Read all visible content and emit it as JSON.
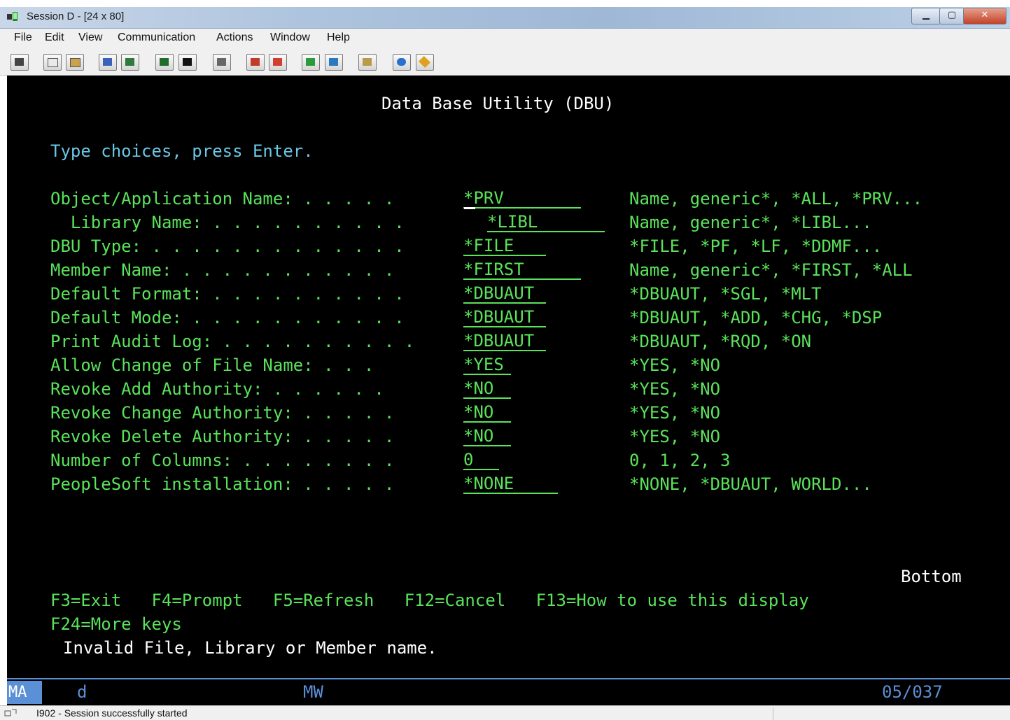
{
  "window": {
    "title": "Session D - [24 x 80]"
  },
  "menu": [
    "File",
    "Edit",
    "View",
    "Communication",
    "Actions",
    "Window",
    "Help"
  ],
  "toolbar_icons": [
    "print-screen-icon",
    "copy-icon",
    "paste-icon",
    "send-icon",
    "receive-icon",
    "display-icon",
    "keypad-icon",
    "macro-icon",
    "record-macro-icon",
    "stop-macro-icon",
    "play-macro-icon",
    "run-macro-icon",
    "clipboard-icon",
    "globe-icon",
    "map-icon"
  ],
  "screen": {
    "title": "Data Base Utility (DBU)",
    "instruction": "Type choices, press Enter.",
    "fields": [
      {
        "label": "Object/Application Name: . . . . .",
        "value": "*PRV",
        "hint": "Name, generic*, *ALL, *PRV..."
      },
      {
        "label": "  Library Name: . . . . . . . . . .",
        "value": "*LIBL",
        "hint": "Name, generic*, *LIBL..."
      },
      {
        "label": "DBU Type: . . . . . . . . . . . . .",
        "value": "*FILE",
        "hint": "*FILE, *PF, *LF, *DDMF..."
      },
      {
        "label": "Member Name: . . . . . . . . . . .",
        "value": "*FIRST",
        "hint": "Name, generic*, *FIRST, *ALL"
      },
      {
        "label": "Default Format: . . . . . . . . . .",
        "value": "*DBUAUT",
        "hint": "*DBUAUT, *SGL, *MLT"
      },
      {
        "label": "Default Mode: . . . . . . . . . . .",
        "value": "*DBUAUT",
        "hint": "*DBUAUT, *ADD, *CHG, *DSP"
      },
      {
        "label": "Print Audit Log: . . . . . . . . . .",
        "value": "*DBUAUT",
        "hint": "*DBUAUT, *RQD, *ON"
      },
      {
        "label": "Allow Change of File Name: . . .",
        "value": "*YES",
        "hint": "*YES, *NO"
      },
      {
        "label": "Revoke Add Authority: . . . . . .",
        "value": "*NO",
        "hint": "*YES, *NO"
      },
      {
        "label": "Revoke Change Authority: . . . . .",
        "value": "*NO",
        "hint": "*YES, *NO"
      },
      {
        "label": "Revoke Delete Authority: . . . . .",
        "value": "*NO",
        "hint": "*YES, *NO"
      },
      {
        "label": "Number of Columns: . . . . . . . .",
        "value": "0",
        "hint": "0, 1, 2, 3"
      },
      {
        "label": "PeopleSoft installation: . . . . .",
        "value": "*NONE",
        "hint": "*NONE, *DBUAUT, WORLD..."
      }
    ],
    "more_indicator": "Bottom",
    "function_keys_line1": "F3=Exit   F4=Prompt   F5=Refresh   F12=Cancel   F13=How to use this display",
    "function_keys_line2": "F24=More keys",
    "message": "Invalid File, Library or Member name."
  },
  "oia": {
    "mode": "MA",
    "session": "d",
    "status": "MW",
    "cursor_pos": "05/037"
  },
  "statusbar": {
    "message": "I902 - Session successfully started"
  },
  "colors": {
    "screen_bg": "#000000",
    "field_green": "#5ae35a",
    "heading_white": "#ffffff",
    "instruction_cyan": "#6ac7e6",
    "oia_blue": "#5b8fd6"
  }
}
